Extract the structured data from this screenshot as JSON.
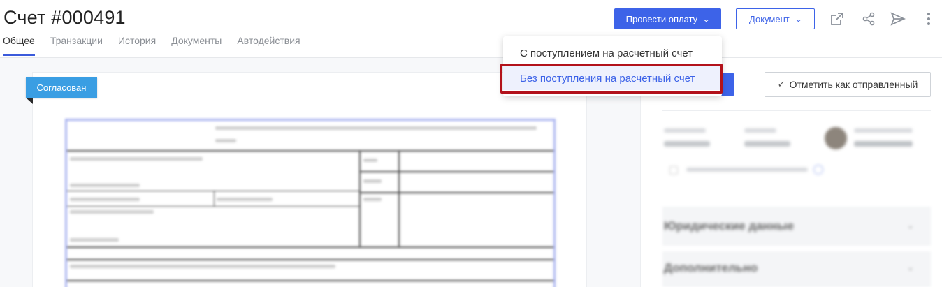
{
  "header": {
    "title": "Счет #000491",
    "pay_button": "Провести оплату",
    "document_button": "Документ"
  },
  "tabs": [
    {
      "label": "Общее",
      "active": true
    },
    {
      "label": "Транзакции",
      "active": false
    },
    {
      "label": "История",
      "active": false
    },
    {
      "label": "Документы",
      "active": false
    },
    {
      "label": "Автодействия",
      "active": false
    }
  ],
  "icons": [
    "external-link-icon",
    "share-icon",
    "send-icon",
    "more-vertical-icon"
  ],
  "dropdown": {
    "items": [
      {
        "label": "С поступлением на расчетный счет"
      },
      {
        "label": "Без поступления на расчетный счет",
        "highlighted": true
      }
    ]
  },
  "document": {
    "status_badge": "Согласован"
  },
  "right_panel": {
    "mark_sent_button": "Отметить как отправленный",
    "section_legal": "Юридические данные",
    "section_extra": "Дополнительно"
  },
  "colors": {
    "primary": "#3d63e8",
    "badge": "#3a9ee3",
    "highlight": "#b3121b"
  }
}
